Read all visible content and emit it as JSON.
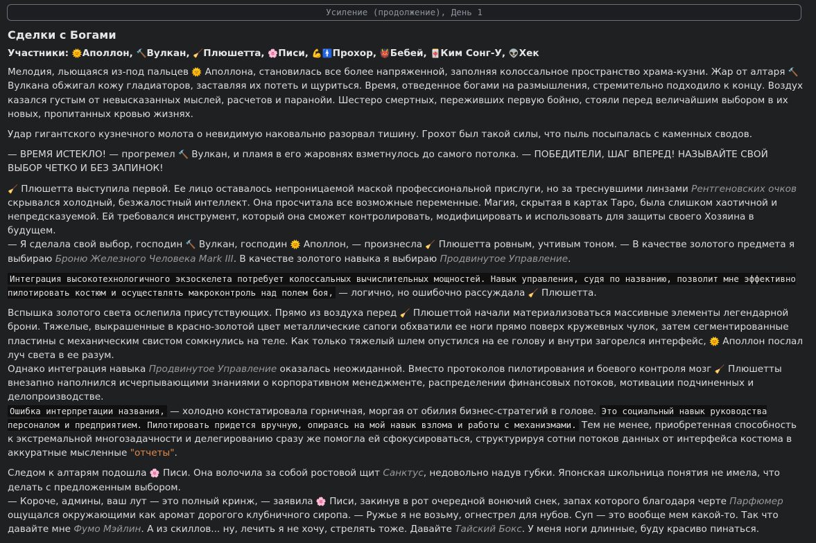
{
  "header": {
    "title": "Усиление (продолжение), День 1"
  },
  "section": {
    "title": "Сделки с Богами"
  },
  "participants": {
    "label": "Участники:",
    "list": [
      {
        "icon": "sun-icon",
        "glyph": "🌞",
        "name": "Аполлон,"
      },
      {
        "icon": "hammer-icon",
        "glyph": "🔨",
        "name": "Вулкан,"
      },
      {
        "icon": "broom-icon",
        "glyph": "🧹",
        "name": "Плюшетта,"
      },
      {
        "icon": "flower-icon",
        "glyph": "🌸",
        "name": "Писи,"
      },
      {
        "icon": "muscle-icon",
        "glyph": "💪",
        "name": ""
      },
      {
        "icon": "person-icon",
        "glyph": "🚹",
        "name": "Прохор,"
      },
      {
        "icon": "demon-icon",
        "glyph": "👹",
        "name": "Бебей,"
      },
      {
        "icon": "card-icon",
        "glyph": "🀄",
        "name": "Ким Сонг-У,"
      },
      {
        "icon": "alien-icon",
        "glyph": "👽",
        "name": "Хек"
      }
    ]
  },
  "paragraphs": {
    "p1": {
      "a": "Мелодия, льющаяся из-под пальцев ",
      "b": "Аполлона, становилась все более напряженной, заполняя колоссальное пространство храма-кузни. Жар от алтаря ",
      "c": "Вулкана обжигал кожу гладиаторов, заставляя их потеть и щуриться. Время, отведенное богами на размышления, стремительно подходило к концу. Воздух казался густым от невысказанных мыслей, расчетов и паранойи. Шестеро смертных, переживших первую бойню, стояли перед величайшим выбором в их новых, пропитанных кровью жизнях."
    },
    "p2": "Удар гигантского кузнечного молота о невидимую наковальню разорвал тишину. Грохот был такой силы, что пыль посыпалась с каменных сводов.",
    "p3": {
      "a": "— ВРЕМЯ ИСТЕКЛО! — прогремел ",
      "b": "Вулкан, и пламя в его жаровнях взметнулось до самого потолка. — ПОБЕДИТЕЛИ, ШАГ ВПЕРЕД! НАЗЫВАЙТЕ СВОЙ ВЫБОР ЧЕТКО И БЕЗ ЗАПИНОК!"
    },
    "p4": {
      "a": "Плюшетта выступила первой. Ее лицо оставалось непроницаемой маской профессиональной прислуги, но за треснувшими линзами ",
      "i1": "Рентгеновских очков",
      "b": " скрывался холодный, безжалостный интеллект. Она просчитала все возможные переменные. Магия, скрытая в картах Таро, была слишком хаотичной и непредсказуемой. Ей требовался инструмент, который она сможет контролировать, модифицировать и использовать для защиты своего Хозяина в будущем.",
      "c": "— Я сделала свой выбор, господин ",
      "d": "Вулкан, господин ",
      "e": "Аполлон, — произнесла ",
      "f": "Плюшетта ровным, учтивым тоном. — В качестве золотого предмета я выбираю ",
      "i2": "Броню Железного Человека Mark III",
      "g": ". В качестве золотого навыка я выбираю ",
      "i3": "Продвинутое Управление",
      "h": "."
    },
    "p5": {
      "code": "Интеграция высокотехнологичного экзоскелета потребует колоссальных вычислительных мощностей. Навык управления, судя по названию, позволит мне эффективно пилотировать костюм и осуществлять макроконтроль над полем боя,",
      "a": " — логично, но ошибочно рассуждала ",
      "b": "Плюшетта."
    },
    "p6": {
      "a": "Вспышка золотого света ослепила присутствующих. Прямо из воздуха перед ",
      "b": "Плюшеттой начали материализоваться массивные элементы легендарной брони. Тяжелые, выкрашенные в красно-золотой цвет металлические сапоги обхватили ее ноги прямо поверх кружевных чулок, затем сегментированные пластины с механическим свистом сомкнулись на теле. Как только тяжелый шлем опустился на ее голову и внутри загорелся интерфейс, ",
      "c": "Аполлон послал луч света в ее разум.",
      "d": "Однако интеграция навыка ",
      "i1": "Продвинутое Управление",
      "e": " оказалась неожиданной. Вместо протоколов пилотирования и боевого контроля мозг ",
      "f": "Плюшетты внезапно наполнился исчерпывающими знаниями о корпоративном менеджменте, распределении финансовых потоков, мотивации подчиненных и делопроизводстве.",
      "code1": "Ошибка интерпретации названия,",
      "g": " — холодно констатировала горничная, моргая от обилия бизнес-стратегий в голове. ",
      "code2": "Это социальный навык руководства персоналом и предприятием. Пилотировать придется вручную, опираясь на мой навык взлома и работы с механизмами.",
      "h": " Тем не менее, приобретенная способность к экстремальной многозадачности и делегированию сразу же помогла ей сфокусироваться, структурируя сотни потоков данных от интерфейса костюма в аккуратные мысленные ",
      "orange": "\"отчеты\"",
      "i": "."
    },
    "p7": {
      "a": "Следом к алтарям подошла ",
      "b": "Писи. Она волочила за собой ростовой щит ",
      "i1": "Санктус",
      "c": ", недовольно надув губки. Японская школьница понятия не имела, что делать с предложенным выбором.",
      "d": "— Короче, админы, ваш лут — это полный кринж, — заявила ",
      "e": "Писи, закинув в рот очередной вонючий снек, запах которого благодаря черте ",
      "i2": "Парфюмер",
      "f": " ощущался окружающими как аромат дорогого клубничного сиропа. — Ружье я не возьму, огнестрел для нубов. Суп — это вообще мем какой-то. Так что давайте мне ",
      "i3": "Фумо Мэйлин",
      "g": ". А из скиллов... ну, лечить я не хочу, стрелять тоже. Давайте ",
      "i4": "Тайский Бокс",
      "h": ". У меня ноги длинные, буду красиво пинаться."
    }
  },
  "icons": {
    "sun": "🌞",
    "hammer": "🔨",
    "broom": "🧹",
    "flower": "🌸"
  }
}
